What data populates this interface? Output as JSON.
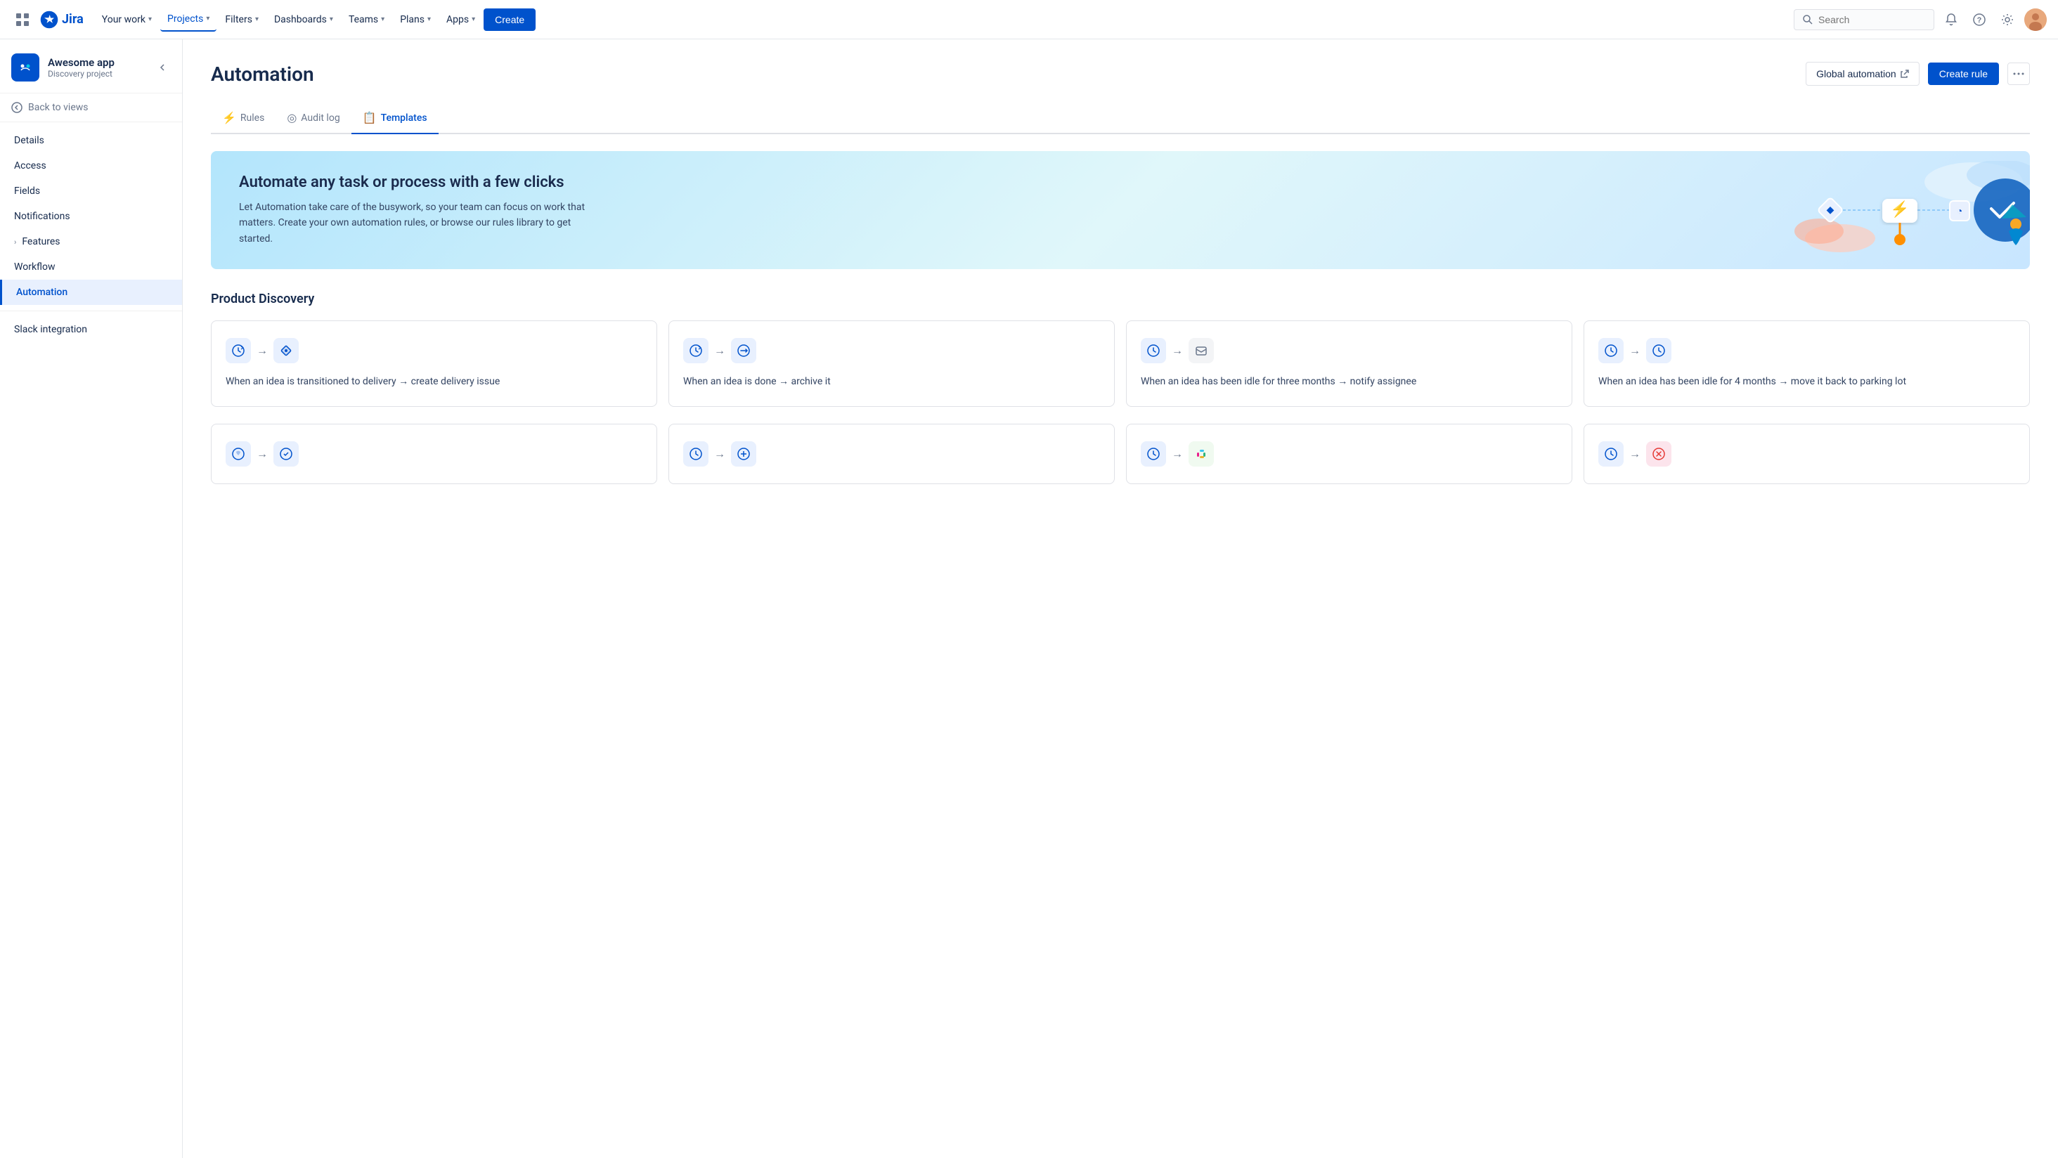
{
  "nav": {
    "items": [
      {
        "label": "Your work",
        "hasChevron": true,
        "active": false
      },
      {
        "label": "Projects",
        "hasChevron": true,
        "active": true
      },
      {
        "label": "Filters",
        "hasChevron": true,
        "active": false
      },
      {
        "label": "Dashboards",
        "hasChevron": true,
        "active": false
      },
      {
        "label": "Teams",
        "hasChevron": true,
        "active": false
      },
      {
        "label": "Plans",
        "hasChevron": true,
        "active": false
      },
      {
        "label": "Apps",
        "hasChevron": true,
        "active": false
      }
    ],
    "create_label": "Create",
    "search_placeholder": "Search"
  },
  "sidebar": {
    "project_name": "Awesome app",
    "project_type": "Discovery project",
    "back_label": "Back to views",
    "nav_items": [
      {
        "label": "Details",
        "active": false,
        "indent": false
      },
      {
        "label": "Access",
        "active": false,
        "indent": false
      },
      {
        "label": "Fields",
        "active": false,
        "indent": false
      },
      {
        "label": "Notifications",
        "active": false,
        "indent": false
      },
      {
        "label": "Features",
        "active": false,
        "indent": false,
        "hasChevron": true
      },
      {
        "label": "Workflow",
        "active": false,
        "indent": false
      },
      {
        "label": "Automation",
        "active": true,
        "indent": false
      },
      {
        "label": "Slack integration",
        "active": false,
        "indent": false
      }
    ]
  },
  "page": {
    "title": "Automation",
    "global_auto_label": "Global automation",
    "create_rule_label": "Create rule"
  },
  "tabs": [
    {
      "label": "Rules",
      "icon": "⚡",
      "active": false
    },
    {
      "label": "Audit log",
      "icon": "◎",
      "active": false
    },
    {
      "label": "Templates",
      "icon": "📋",
      "active": true
    }
  ],
  "banner": {
    "title": "Automate any task or process with a few clicks",
    "description": "Let Automation take care of the busywork, so your team can focus on work that matters. Create your own automation rules, or browse our rules library to get started."
  },
  "section": {
    "title": "Product Discovery"
  },
  "cards_row1": [
    {
      "icon1": "↻",
      "icon1_type": "blue",
      "icon2": "◆",
      "icon2_type": "diamond",
      "text": "When an idea is transitioned to delivery → create delivery issue"
    },
    {
      "icon1": "↻",
      "icon1_type": "blue",
      "icon2": "↻",
      "icon2_type": "blue",
      "text": "When an idea is done → archive it"
    },
    {
      "icon1": "↻",
      "icon1_type": "blue",
      "icon2": "✉",
      "icon2_type": "mail",
      "text": "When an idea has been idle for three months → notify assignee"
    },
    {
      "icon1": "↻",
      "icon1_type": "blue",
      "icon2": "↻",
      "icon2_type": "blue",
      "text": "When an idea has been idle for 4 months → move it back to parking lot"
    }
  ],
  "cards_row2": [
    {
      "icon1": "↺",
      "icon1_type": "blue",
      "icon2": "↺",
      "icon2_type": "blue",
      "text": ""
    },
    {
      "icon1": "↺",
      "icon1_type": "blue",
      "icon2": "↻",
      "icon2_type": "blue",
      "text": ""
    },
    {
      "icon1": "↺",
      "icon1_type": "blue",
      "icon2": "slack",
      "icon2_type": "slack",
      "text": ""
    },
    {
      "icon1": "↺",
      "icon1_type": "blue",
      "icon2": "✕",
      "icon2_type": "cancel",
      "text": ""
    }
  ]
}
